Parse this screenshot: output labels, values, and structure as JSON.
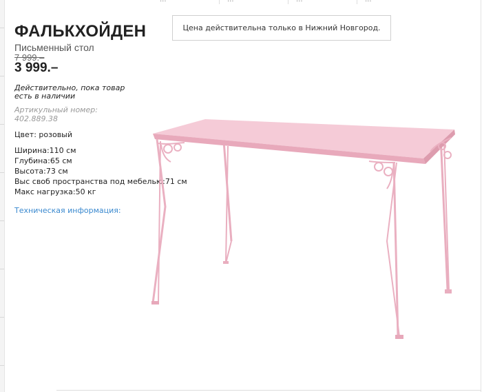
{
  "top_strip": {
    "crumbs": [
      "...",
      "...",
      "...",
      "..."
    ]
  },
  "product": {
    "name": "ФАЛЬКХОЙДЕН",
    "type": "Письменный стол",
    "old_price": "7 999.–",
    "price": "3 999.–",
    "availability": "Действительно, пока товар есть в наличии",
    "article": "Артикульный номер: 402.889.38",
    "color": "Цвет: розовый",
    "dimensions": [
      "Ширина:110 см",
      "Глубина:65 см",
      "Высота:73 см",
      "Выс своб пространства под мебелью:71 см",
      "Макс нагрузка:50 кг"
    ],
    "tech_info_link": "Техническая информация:"
  },
  "price_note": "Цена действительна только в Нижний Новгород.",
  "colors": {
    "table_pink": "#f3c4d1",
    "table_pink_dark": "#e6a7b9",
    "link_blue": "#3a89cf"
  }
}
